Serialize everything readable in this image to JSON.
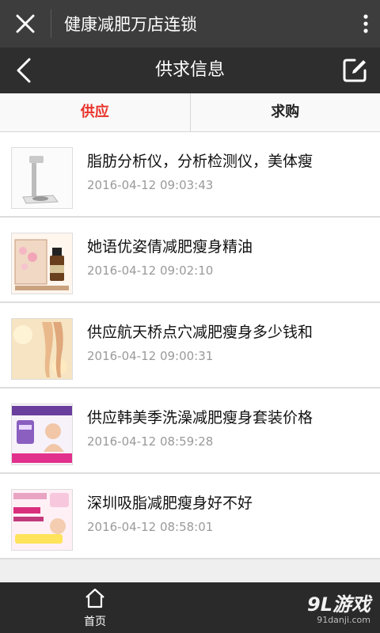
{
  "window": {
    "title": "健康减肥万店连锁"
  },
  "nav": {
    "title": "供求信息"
  },
  "tabs": [
    {
      "label": "供应",
      "active": true
    },
    {
      "label": "求购",
      "active": false
    }
  ],
  "items": [
    {
      "name": "脂肪分析仪，分析检测仪，美体瘦",
      "time": "2016-04-12 09:03:43"
    },
    {
      "name": "她语优姿倩减肥瘦身精油",
      "time": "2016-04-12 09:02:10"
    },
    {
      "name": "供应航天桥点穴减肥瘦身多少钱和",
      "time": "2016-04-12 09:00:31"
    },
    {
      "name": "供应韩美季洗澡减肥瘦身套装价格",
      "time": "2016-04-12 08:59:28"
    },
    {
      "name": "深圳吸脂减肥瘦身好不好",
      "time": "2016-04-12 08:58:01"
    }
  ],
  "bottom": {
    "home_label": "首页"
  },
  "watermark": {
    "brand": "9L游戏",
    "url": "91danji.com"
  },
  "colors": {
    "accent": "#e8322a",
    "topbar": "#3d3d3d",
    "navbar": "#2e2e2e",
    "bottombar": "#2a2a2a"
  },
  "icons": [
    "close-icon",
    "more-vert-icon",
    "back-icon",
    "edit-icon",
    "home-icon"
  ]
}
